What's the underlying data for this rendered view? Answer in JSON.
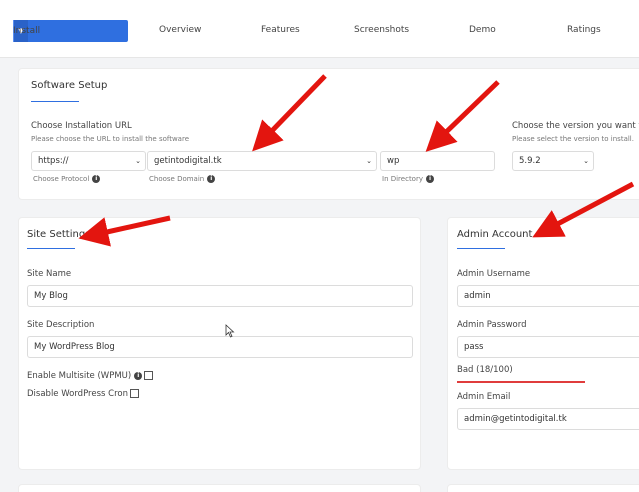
{
  "tabs": {
    "install_label": "Install",
    "items": [
      "Overview",
      "Features",
      "Screenshots",
      "Demo",
      "Ratings"
    ]
  },
  "software_setup": {
    "title": "Software Setup",
    "url_label": "Choose Installation URL",
    "url_hint": "Please choose the URL to install the software",
    "protocol_value": "https://",
    "protocol_hint": "Choose Protocol",
    "domain_value": "getintodigital.tk",
    "domain_hint": "Choose Domain",
    "directory_value": "wp",
    "directory_hint": "In Directory",
    "version_label": "Choose the version you want t",
    "version_hint": "Please select the version to install.",
    "version_value": "5.9.2"
  },
  "site_settings": {
    "title": "Site Settings",
    "site_name_label": "Site Name",
    "site_name_value": "My Blog",
    "site_desc_label": "Site Description",
    "site_desc_value": "My WordPress Blog",
    "multisite_label": "Enable Multisite (WPMU)",
    "cron_label": "Disable WordPress Cron"
  },
  "admin_account": {
    "title": "Admin Account",
    "username_label": "Admin Username",
    "username_value": "admin",
    "password_label": "Admin Password",
    "password_value": "pass",
    "strength_text": "Bad (18/100)",
    "email_label": "Admin Email",
    "email_value": "admin@getintodigital.tk"
  },
  "colors": {
    "accent": "#2f6fe0",
    "arrow": "#e3150f",
    "strength_bad": "#e03c3c"
  }
}
